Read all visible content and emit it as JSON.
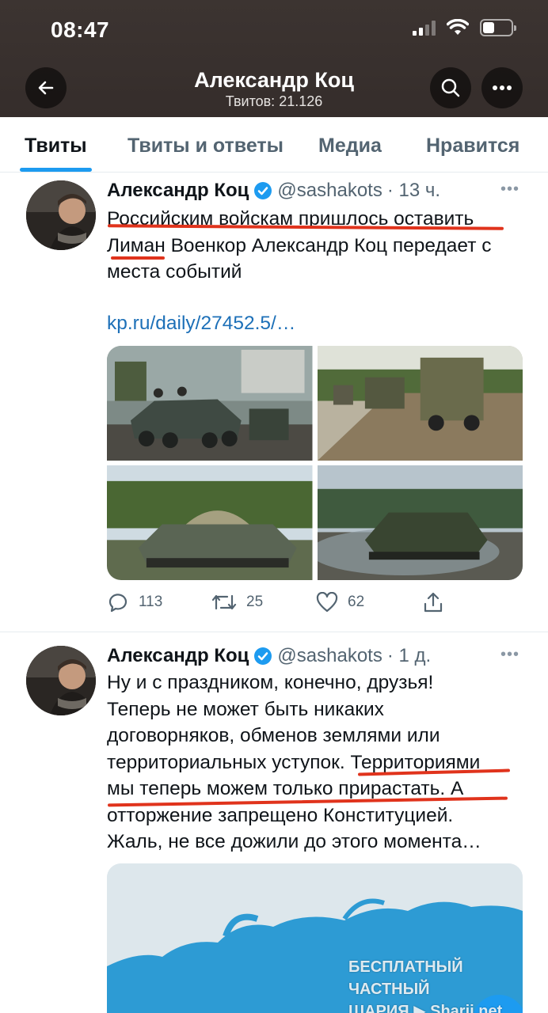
{
  "status_bar": {
    "time": "08:47"
  },
  "header": {
    "title": "Александр Коц",
    "subtitle": "Твитов: 21.126"
  },
  "tabs": [
    {
      "label": "Твиты",
      "active": true
    },
    {
      "label": "Твиты и ответы",
      "active": false
    },
    {
      "label": "Медиа",
      "active": false
    },
    {
      "label": "Нравится",
      "active": false
    }
  ],
  "tweets": [
    {
      "name": "Александр Коц",
      "handle": "@sashakots",
      "time": "· 13 ч.",
      "lines": [
        "Российским войскам пришлось оставить",
        "Лиман Военкор Александр Коц передает с",
        "места событий"
      ],
      "link": "kp.ru/daily/27452.5/…",
      "media_icons": [
        "armored-vehicles-photo",
        "military-trucks-photo",
        "tank-photo",
        "tank-dust-photo"
      ],
      "stats": {
        "replies": "113",
        "retweets": "25",
        "likes": "62"
      }
    },
    {
      "name": "Александр Коц",
      "handle": "@sashakots",
      "time": "· 1 д.",
      "lines": [
        "Ну и с праздником, конечно, друзья!",
        "Теперь не может быть никаких",
        "договорняков, обменов землями или",
        "территориальных уступок. Территориями",
        "мы теперь можем только прирастать. А",
        "отторжение запрещено Конституцией.",
        "Жаль, не все дожили до этого момента…"
      ]
    }
  ],
  "watermark": {
    "line1": "БЕСПЛАТНЫЙ ЧАСТНЫЙ",
    "line2": "ШАРИЯ ▶ Sharij.net"
  },
  "colors": {
    "accent": "#1d9bf0",
    "underline": "#e0331c",
    "header_bg": "#3c3431"
  }
}
